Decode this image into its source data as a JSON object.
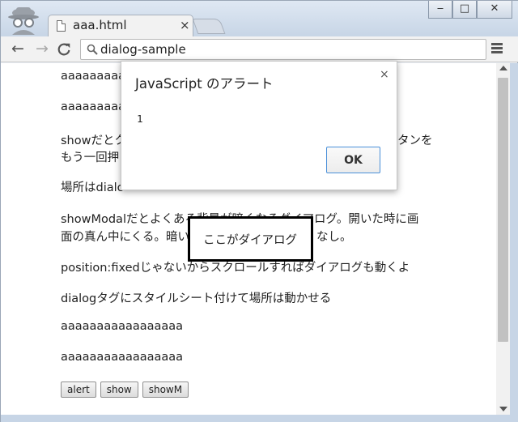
{
  "browser": {
    "tab": {
      "title": "aaa.html",
      "close_glyph": "×"
    },
    "window_controls": {
      "minimize": "‒",
      "maximize": "□",
      "close": "✕"
    },
    "nav": {
      "back": "←",
      "forward": "→",
      "reload": "C"
    },
    "address_bar": {
      "value": "dialog-sample"
    }
  },
  "page": {
    "lines": [
      "aaaaaaaaa",
      "aaaaaaaaa",
      "showだとク",
      "もう一回押",
      "場所はdialo",
      "showModalだとよくある背景が暗くなるダイアログ。開いた時に画",
      "面の真ん中にくる。暗い",
      "position:fixedじゃないからスクロールすればダイアログも動くよ",
      "dialogタグにスタイルシート付けて場所は動かせる",
      "aaaaaaaaaaaaaaaaa",
      "aaaaaaaaaaaaaaaaa"
    ],
    "partial_right": [
      "タンを",
      "なし。"
    ],
    "buttons": [
      "alert",
      "show",
      "showM"
    ]
  },
  "dialog": {
    "text": "ここがダイアログ"
  },
  "alert": {
    "title": "JavaScript のアラート",
    "close_glyph": "×",
    "message": "1",
    "ok_label": "OK"
  },
  "colors": {
    "accent": "#4a90d9",
    "scroll_thumb": "#c1c1c1"
  },
  "icons": [
    "incognito-icon",
    "document-icon",
    "search-icon",
    "menu-icon",
    "back-arrow-icon",
    "forward-arrow-icon",
    "reload-icon"
  ]
}
